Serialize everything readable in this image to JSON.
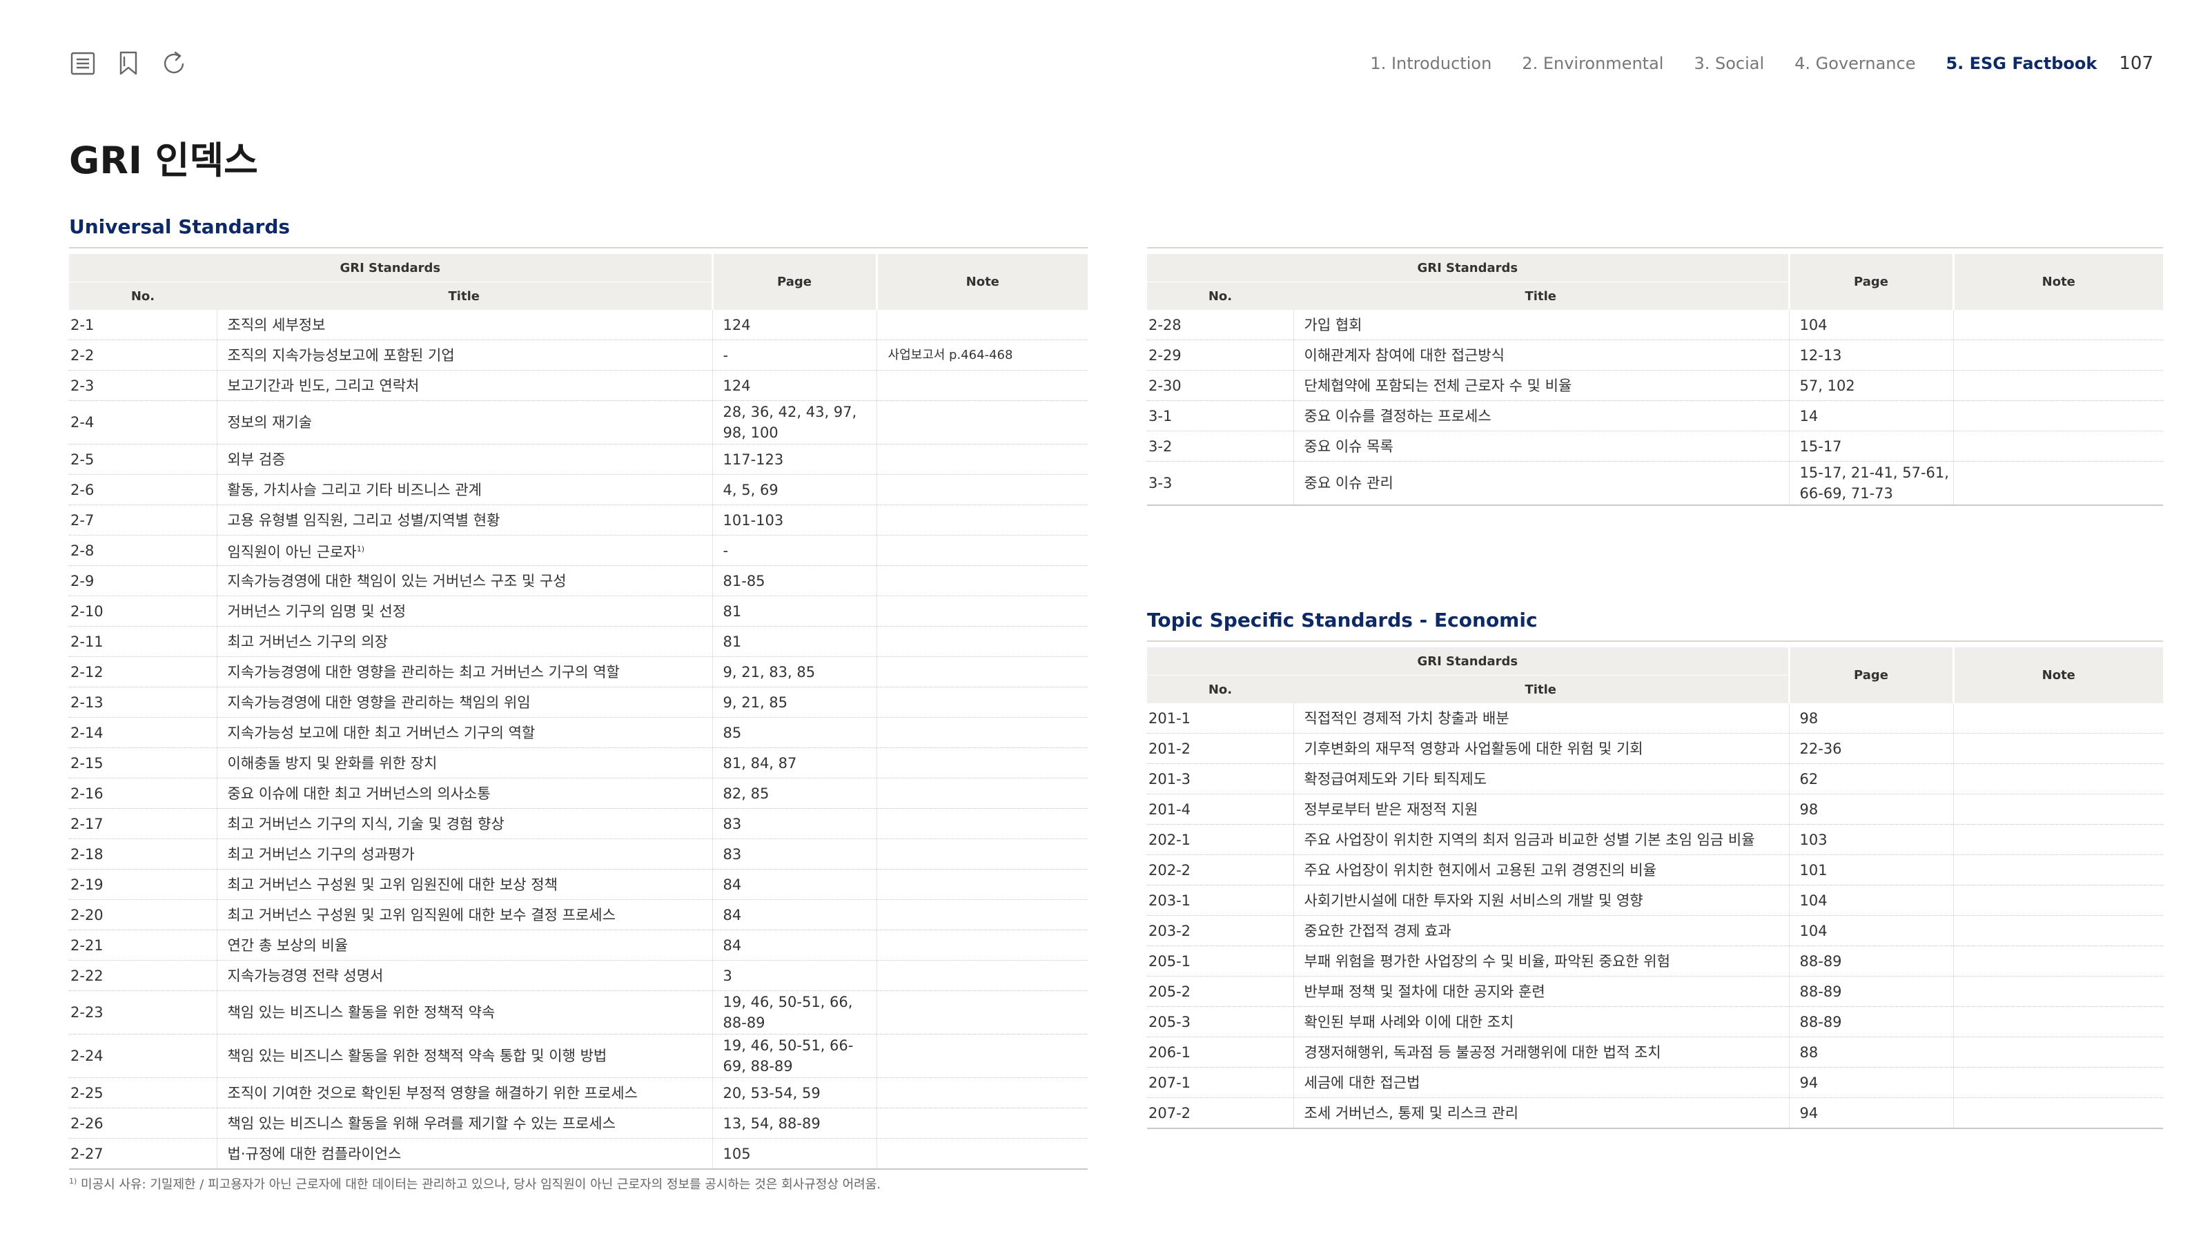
{
  "nav": {
    "items": [
      "1. Introduction",
      "2. Environmental",
      "3. Social",
      "4. Governance",
      "5. ESG Factbook"
    ],
    "page_number": "107"
  },
  "page_title": "GRI 인덱스",
  "headers": {
    "gri_standards": "GRI Standards",
    "no": "No.",
    "title": "Title",
    "page": "Page",
    "note": "Note"
  },
  "universal": {
    "section_title": "Universal Standards",
    "rows_left": [
      {
        "no": "2-1",
        "title": "조직의 세부정보",
        "page": "124",
        "note": ""
      },
      {
        "no": "2-2",
        "title": "조직의 지속가능성보고에 포함된 기업",
        "page": "-",
        "note": "사업보고서 p.464-468"
      },
      {
        "no": "2-3",
        "title": "보고기간과 빈도, 그리고 연락처",
        "page": "124",
        "note": ""
      },
      {
        "no": "2-4",
        "title": "정보의 재기술",
        "page": "28, 36, 42, 43, 97, 98, 100",
        "note": ""
      },
      {
        "no": "2-5",
        "title": "외부 검증",
        "page": "117-123",
        "note": ""
      },
      {
        "no": "2-6",
        "title": "활동, 가치사슬 그리고 기타 비즈니스 관계",
        "page": "4, 5, 69",
        "note": ""
      },
      {
        "no": "2-7",
        "title": "고용 유형별 임직원, 그리고 성별/지역별 현황",
        "page": "101-103",
        "note": ""
      },
      {
        "no": "2-8",
        "title": "임직원이 아닌 근로자",
        "sup": "1)",
        "page": "-",
        "note": ""
      },
      {
        "no": "2-9",
        "title": "지속가능경영에 대한 책임이 있는 거버넌스 구조 및 구성",
        "page": "81-85",
        "note": ""
      },
      {
        "no": "2-10",
        "title": "거버넌스 기구의 임명 및 선정",
        "page": "81",
        "note": ""
      },
      {
        "no": "2-11",
        "title": "최고 거버넌스 기구의 의장",
        "page": "81",
        "note": ""
      },
      {
        "no": "2-12",
        "title": "지속가능경영에 대한 영향을 관리하는 최고 거버넌스 기구의 역할",
        "page": "9, 21, 83, 85",
        "note": ""
      },
      {
        "no": "2-13",
        "title": "지속가능경영에 대한 영향을 관리하는 책임의 위임",
        "page": "9, 21, 85",
        "note": ""
      },
      {
        "no": "2-14",
        "title": "지속가능성 보고에 대한 최고 거버넌스 기구의 역할",
        "page": "85",
        "note": ""
      },
      {
        "no": "2-15",
        "title": "이해충돌 방지 및 완화를 위한 장치",
        "page": "81, 84, 87",
        "note": ""
      },
      {
        "no": "2-16",
        "title": "중요 이슈에 대한 최고 거버넌스의 의사소통",
        "page": "82, 85",
        "note": ""
      },
      {
        "no": "2-17",
        "title": "최고 거버넌스 기구의 지식, 기술 및 경험 향상",
        "page": "83",
        "note": ""
      },
      {
        "no": "2-18",
        "title": "최고 거버넌스 기구의 성과평가",
        "page": "83",
        "note": ""
      },
      {
        "no": "2-19",
        "title": "최고 거버넌스 구성원 및 고위 임원진에 대한 보상 정책",
        "page": "84",
        "note": ""
      },
      {
        "no": "2-20",
        "title": "최고 거버넌스 구성원 및 고위 임직원에 대한 보수 결정 프로세스",
        "page": "84",
        "note": ""
      },
      {
        "no": "2-21",
        "title": "연간 총 보상의 비율",
        "page": "84",
        "note": ""
      },
      {
        "no": "2-22",
        "title": "지속가능경영 전략 성명서",
        "page": "3",
        "note": ""
      },
      {
        "no": "2-23",
        "title": "책임 있는 비즈니스 활동을 위한 정책적 약속",
        "page": "19, 46, 50-51, 66, 88-89",
        "note": ""
      },
      {
        "no": "2-24",
        "title": "책임 있는 비즈니스 활동을 위한 정책적 약속 통합 및 이행 방법",
        "page": "19, 46, 50-51, 66-69, 88-89",
        "note": ""
      },
      {
        "no": "2-25",
        "title": "조직이 기여한 것으로 확인된 부정적 영향을 해결하기 위한 프로세스",
        "page": "20, 53-54, 59",
        "note": ""
      },
      {
        "no": "2-26",
        "title": "책임 있는 비즈니스 활동을 위해 우려를 제기할 수 있는 프로세스",
        "page": "13, 54, 88-89",
        "note": ""
      },
      {
        "no": "2-27",
        "title": "법·규정에 대한 컴플라이언스",
        "page": "105",
        "note": ""
      }
    ],
    "rows_right": [
      {
        "no": "2-28",
        "title": "가입 협회",
        "page": "104",
        "note": ""
      },
      {
        "no": "2-29",
        "title": "이해관계자 참여에 대한 접근방식",
        "page": "12-13",
        "note": ""
      },
      {
        "no": "2-30",
        "title": "단체협약에 포함되는 전체 근로자 수 및 비율",
        "page": "57, 102",
        "note": ""
      },
      {
        "no": "3-1",
        "title": "중요 이슈를 결정하는 프로세스",
        "page": "14",
        "note": ""
      },
      {
        "no": "3-2",
        "title": "중요 이슈 목록",
        "page": "15-17",
        "note": ""
      },
      {
        "no": "3-3",
        "title": "중요 이슈 관리",
        "page": "15-17, 21-41, 57-61, 66-69, 71-73",
        "note": ""
      }
    ]
  },
  "economic": {
    "section_title": "Topic Specific Standards - Economic",
    "rows": [
      {
        "no": "201-1",
        "title": "직접적인 경제적 가치 창출과 배분",
        "page": "98",
        "note": ""
      },
      {
        "no": "201-2",
        "title": "기후변화의 재무적 영향과 사업활동에 대한 위험 및 기회",
        "page": "22-36",
        "note": ""
      },
      {
        "no": "201-3",
        "title": "확정급여제도와 기타 퇴직제도",
        "page": "62",
        "note": ""
      },
      {
        "no": "201-4",
        "title": "정부로부터 받은 재정적 지원",
        "page": "98",
        "note": ""
      },
      {
        "no": "202-1",
        "title": "주요 사업장이 위치한 지역의 최저 임금과 비교한 성별 기본 초임 임금 비율",
        "page": "103",
        "note": ""
      },
      {
        "no": "202-2",
        "title": "주요 사업장이 위치한 현지에서 고용된 고위 경영진의 비율",
        "page": "101",
        "note": ""
      },
      {
        "no": "203-1",
        "title": "사회기반시설에 대한 투자와 지원 서비스의 개발 및 영향",
        "page": "104",
        "note": ""
      },
      {
        "no": "203-2",
        "title": "중요한 간접적 경제 효과",
        "page": "104",
        "note": ""
      },
      {
        "no": "205-1",
        "title": "부패 위험을 평가한 사업장의 수 및 비율, 파악된 중요한 위험",
        "page": "88-89",
        "note": ""
      },
      {
        "no": "205-2",
        "title": "반부패 정책 및 절차에 대한 공지와 훈련",
        "page": "88-89",
        "note": ""
      },
      {
        "no": "205-3",
        "title": "확인된 부패 사례와 이에 대한 조치",
        "page": "88-89",
        "note": ""
      },
      {
        "no": "206-1",
        "title": "경쟁저해행위, 독과점 등 불공정 거래행위에 대한 법적 조치",
        "page": "88",
        "note": ""
      },
      {
        "no": "207-1",
        "title": "세금에 대한 접근법",
        "page": "94",
        "note": ""
      },
      {
        "no": "207-2",
        "title": "조세 거버넌스, 통제 및 리스크 관리",
        "page": "94",
        "note": ""
      }
    ]
  },
  "footnote": {
    "marker": "1)",
    "text": " 미공시 사유: 기밀제한 / 피고용자가 아닌 근로자에 대한 데이터는 관리하고 있으나, 당사 임직원이 아닌 근로자의 정보를 공시하는 것은 회사규정상 어려움."
  },
  "colors": {
    "accent": "#0d2a66",
    "header_bg": "#f0eeea",
    "text": "#333333"
  },
  "icons": [
    "list-icon",
    "bookmark-icon",
    "refresh-icon"
  ]
}
